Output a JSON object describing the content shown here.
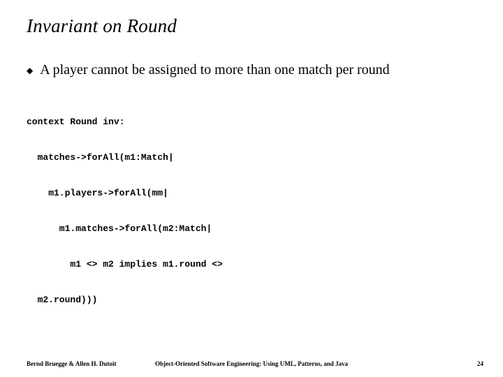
{
  "title": "Invariant on Round",
  "bullet_glyph": "◆",
  "bullet_text": "A player cannot be assigned to more than one match per round",
  "code_lines": [
    "context Round inv:",
    "  matches->forAll(m1:Match|",
    "    m1.players->forAll(mm|",
    "      m1.matches->forAll(m2:Match|",
    "        m1 <> m2 implies m1.round <>",
    "  m2.round)))"
  ],
  "footer": {
    "left": "Bernd Bruegge & Allen H. Dutoit",
    "center": "Object-Oriented Software Engineering: Using UML, Patterns, and Java",
    "page": "24"
  }
}
